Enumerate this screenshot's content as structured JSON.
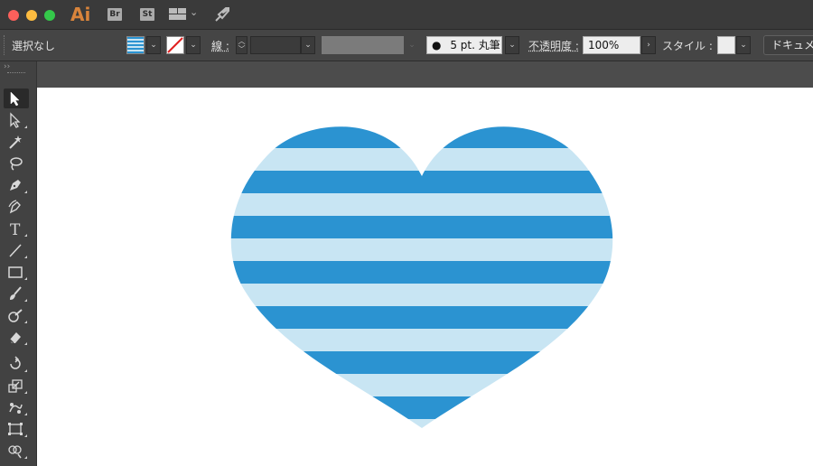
{
  "app": {
    "logo_text": "Ai",
    "bridge_badge": "Br",
    "stock_badge": "St",
    "brand_color": "#d9843b"
  },
  "titlebar_icons": [
    "workspace-switcher-icon",
    "chevron-down-icon",
    "rocket-icon"
  ],
  "control_bar": {
    "selection_status": "選択なし",
    "stroke_label": "線 :",
    "brush_label": "5 pt. 丸筆",
    "opacity_label": "不透明度 :",
    "opacity_value": "100%",
    "style_label": "スタイル :",
    "document_button": "ドキュメ"
  },
  "tools": [
    {
      "name": "selection-tool-icon",
      "selected": true
    },
    {
      "name": "direct-selection-tool-icon"
    },
    {
      "name": "magic-wand-tool-icon"
    },
    {
      "name": "lasso-tool-icon"
    },
    {
      "name": "pen-tool-icon"
    },
    {
      "name": "curvature-tool-icon"
    },
    {
      "name": "type-tool-icon",
      "glyph": "T"
    },
    {
      "name": "line-segment-tool-icon"
    },
    {
      "name": "rectangle-tool-icon"
    },
    {
      "name": "paintbrush-tool-icon"
    },
    {
      "name": "shaper-tool-icon"
    },
    {
      "name": "eraser-tool-icon"
    },
    {
      "name": "rotate-tool-icon"
    },
    {
      "name": "scale-tool-icon"
    },
    {
      "name": "puppet-warp-tool-icon"
    },
    {
      "name": "free-transform-tool-icon"
    },
    {
      "name": "shape-builder-tool-icon"
    }
  ],
  "colors": {
    "stripe_dark": "#2b93d1",
    "stripe_light": "#c8e5f3",
    "canvas": "#ffffff",
    "ui_dark": "#424242"
  }
}
